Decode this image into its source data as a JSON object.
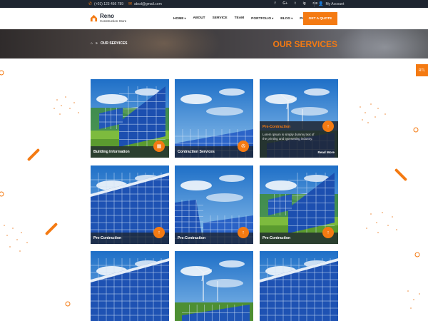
{
  "topbar": {
    "phone": "(+01) 123 456 789",
    "email": "abcd@gmail.com",
    "social": [
      "f",
      "G+",
      "t",
      "ig",
      "rss"
    ],
    "account": "My Account"
  },
  "header": {
    "logo_title": "Reno",
    "logo_subtitle": "Construction Store",
    "nav": [
      "HOME",
      "ABOUT",
      "SERVICE",
      "TEAM",
      "PORTFOLIO",
      "BLOG",
      "PAGE"
    ],
    "quote_label": "GET A QUOTE"
  },
  "banner": {
    "breadcrumb_sep": "»",
    "breadcrumb_current": "OUR SERVICES",
    "title": "OUR SERVICES"
  },
  "rtl_label": "RTL",
  "colors": {
    "accent": "#f47a12",
    "dark": "#1e2530"
  },
  "cards": [
    {
      "label": "Building Information",
      "icon": "brick-icon"
    },
    {
      "label": "Contraction Services",
      "icon": "tools-icon"
    },
    {
      "label": "Pre-Contraction",
      "icon": "arrow-icon",
      "text": "Lorem Ipsum is simply dummy text of the printing and typesetting industry.",
      "more": "Read More"
    },
    {
      "label": "Pre-Contraction",
      "icon": "arrow-icon"
    },
    {
      "label": "Pre-Contraction",
      "icon": "arrow-icon"
    },
    {
      "label": "Pre-Contraction",
      "icon": "arrow-icon"
    },
    {
      "label": "",
      "icon": ""
    },
    {
      "label": "",
      "icon": ""
    },
    {
      "label": "",
      "icon": ""
    }
  ]
}
